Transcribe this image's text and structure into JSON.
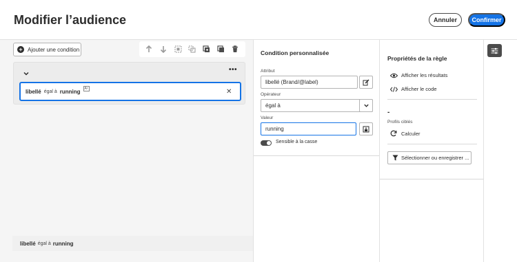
{
  "header": {
    "title": "Modifier l’audience",
    "cancel_label": "Annuler",
    "confirm_label": "Confirmer"
  },
  "canvas": {
    "add_condition_label": "Ajouter une condition",
    "toolbar_icons": [
      "arrow-up-icon",
      "arrow-down-icon",
      "group-icon",
      "ungroup-icon",
      "duplicate-icon",
      "copy-icon",
      "delete-icon"
    ],
    "condition": {
      "attribute": "libellé",
      "operator": "égal à",
      "value": "running",
      "badge": "Aᶜ"
    },
    "summary": {
      "attribute": "libellé",
      "operator": "égal à",
      "value": "running"
    }
  },
  "condition_panel": {
    "title": "Condition personnalisée",
    "attribute_label": "Attribut",
    "attribute_value": "libellé (Brand/@label)",
    "operator_label": "Opérateur",
    "operator_value": "égal à",
    "value_label": "Valeur",
    "value_value": "running",
    "case_sensitive_label": "Sensible à la casse",
    "case_sensitive_on": true
  },
  "rule_properties": {
    "title": "Propriétés de la règle",
    "show_results": "Afficher les résultats",
    "show_code": "Afficher le code",
    "count_value": "-",
    "targeted_profiles_label": "Profils ciblés",
    "calculate_label": "Calculer",
    "select_or_save_label": "Sélectionner ou enregistrer ..."
  },
  "colors": {
    "accent": "#1473e6",
    "dark": "#4b4b4b"
  }
}
